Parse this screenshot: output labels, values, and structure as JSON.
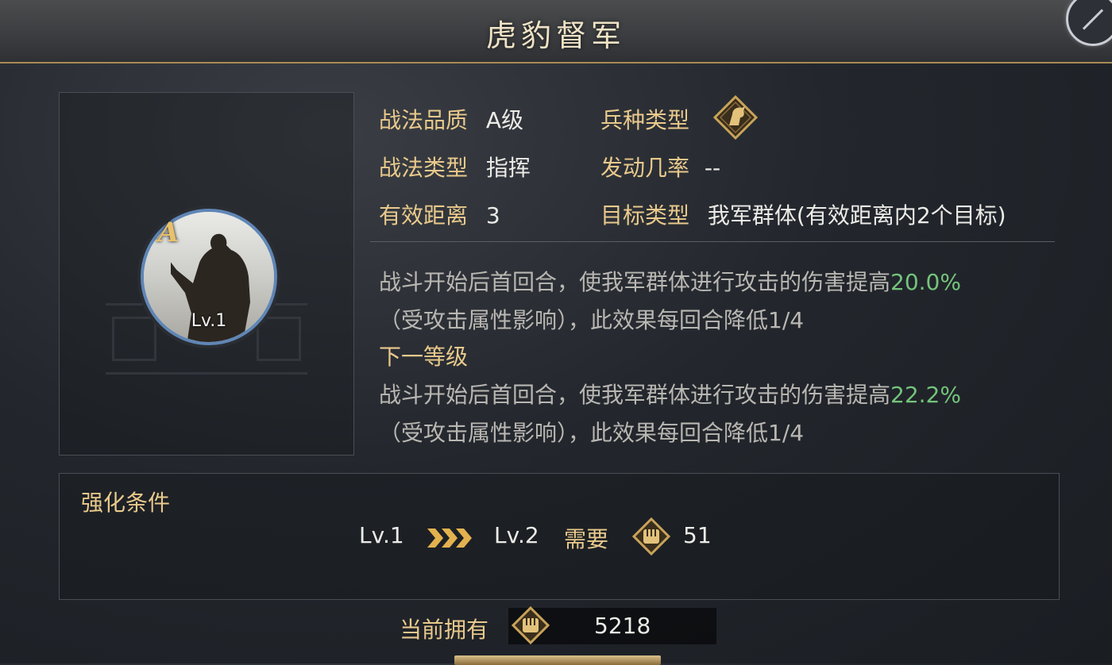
{
  "title": "虎豹督军",
  "skill": {
    "grade_letter": "A",
    "level": "Lv.1"
  },
  "info": {
    "quality_label": "战法品质",
    "quality_value": "A级",
    "troop_label": "兵种类型",
    "troop_icon": "cavalry-horse-icon",
    "type_label": "战法类型",
    "type_value": "指挥",
    "rate_label": "发动几率",
    "rate_value": "--",
    "range_label": "有效距离",
    "range_value": "3",
    "target_label": "目标类型",
    "target_value": "我军群体(有效距离内2个目标)"
  },
  "description": {
    "current_line1_prefix": "战斗开始后首回合，使我军群体进行攻击的伤害提高",
    "current_line1_value": "20.0%",
    "current_line2": "（受攻击属性影响），此效果每回合降低1/4",
    "next_level_label": "下一等级",
    "next_line1_prefix": "战斗开始后首回合，使我军群体进行攻击的伤害提高",
    "next_line1_value": "22.2%",
    "next_line2": "（受攻击属性影响），此效果每回合降低1/4"
  },
  "upgrade": {
    "title": "强化条件",
    "from_level": "Lv.1",
    "to_level": "Lv.2",
    "need_label": "需要",
    "cost": "51",
    "currency_icon": "fist-icon"
  },
  "owned": {
    "label": "当前拥有",
    "amount": "5218"
  },
  "colors": {
    "label_gold": "#e9c98c",
    "highlight_green": "#74c47c",
    "ring_blue": "#5f86b5"
  }
}
